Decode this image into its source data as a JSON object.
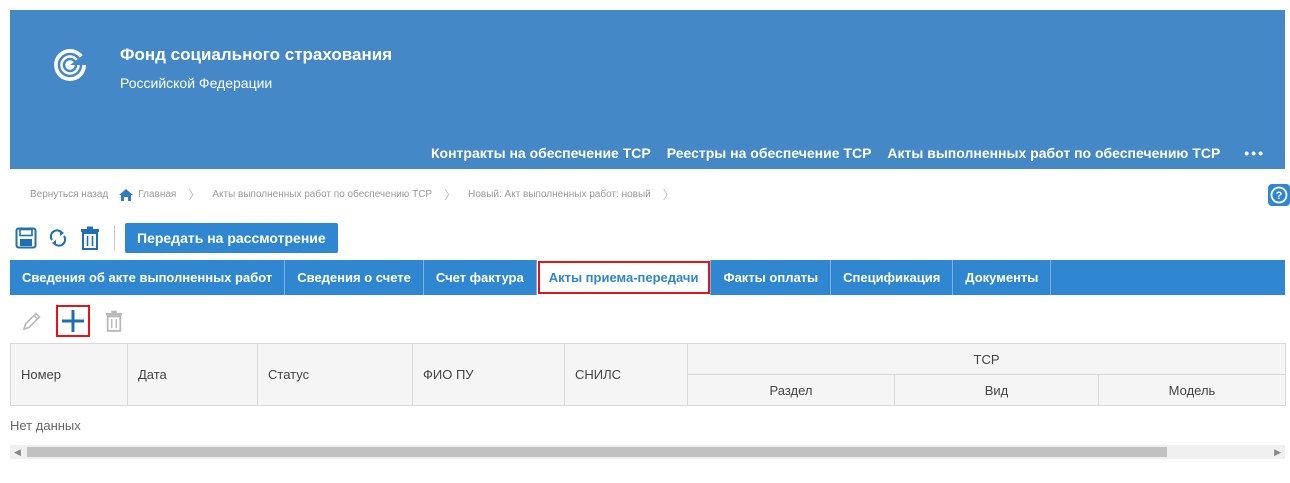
{
  "header": {
    "org_name": "Фонд социального страхования",
    "org_sub": "Российской Федерации",
    "bg_color": "#4488c7",
    "nav": [
      {
        "label": "Контракты на обеспечение ТСР"
      },
      {
        "label": "Реестры на обеспечение ТСР"
      },
      {
        "label": "Акты выполненных работ по обеспечению ТСР"
      }
    ],
    "more_label": "•••"
  },
  "breadcrumb": {
    "back": "Вернуться назад",
    "home": "Главная",
    "section": "Акты выполненных работ по обеспечению ТСР",
    "current": "Новый: Акт выполненных работ: новый",
    "sep": "〉"
  },
  "toolbar": {
    "submit_label": "Передать на рассмотрение",
    "accent": "#2f86d1"
  },
  "tabs": [
    {
      "label": "Сведения об акте выполненных работ"
    },
    {
      "label": "Сведения о счете"
    },
    {
      "label": "Счет фактура"
    },
    {
      "label": "Акты приема-передачи",
      "active": true
    },
    {
      "label": "Факты оплаты"
    },
    {
      "label": "Спецификация"
    },
    {
      "label": "Документы"
    }
  ],
  "table": {
    "columns": {
      "number": "Номер",
      "date": "Дата",
      "status": "Статус",
      "fio": "ФИО ПУ",
      "snils": "СНИЛС",
      "tsr_group": "ТСР",
      "section": "Раздел",
      "kind": "Вид",
      "model": "Модель"
    },
    "empty_text": "Нет данных"
  },
  "icons": {
    "save": "save-icon",
    "refresh": "refresh-icon",
    "delete": "trash-icon",
    "edit": "pencil-icon",
    "add": "plus-icon",
    "help": "help-icon"
  },
  "highlight_color": "#e3141c"
}
